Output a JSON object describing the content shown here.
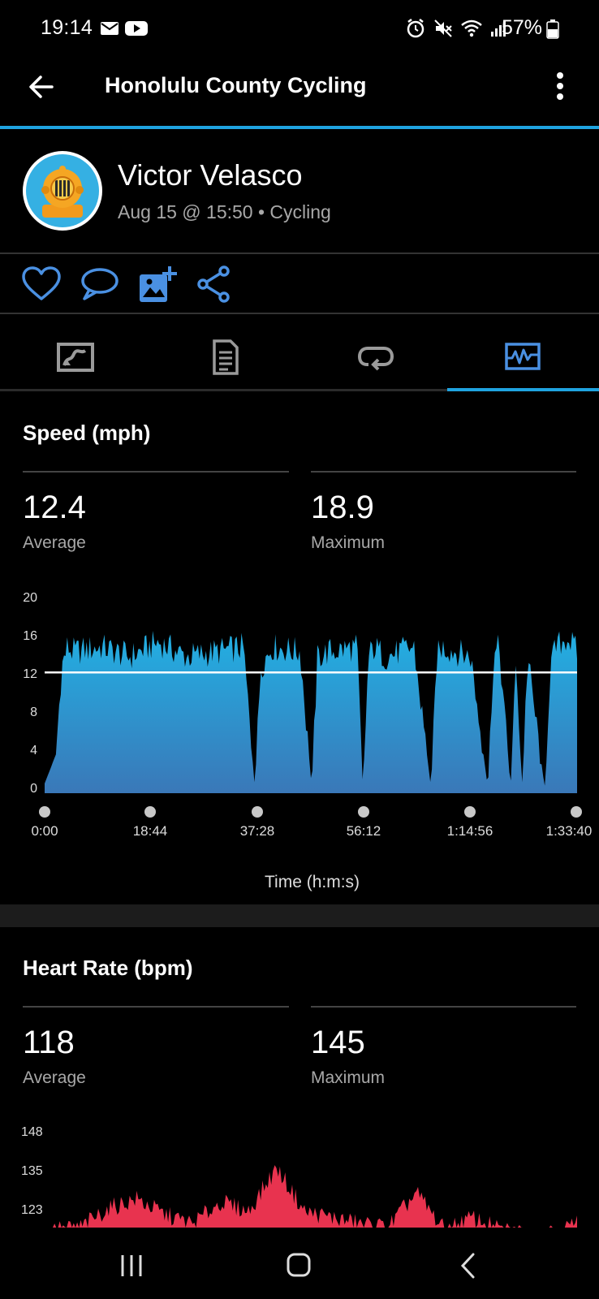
{
  "status_bar": {
    "time": "19:14",
    "battery": "57%"
  },
  "app_bar": {
    "title": "Honolulu County Cycling"
  },
  "activity": {
    "user_name": "Victor Velasco",
    "subline": "Aug 15 @ 15:50 • Cycling"
  },
  "speed": {
    "title": "Speed (mph)",
    "average": "12.4",
    "average_label": "Average",
    "maximum": "18.9",
    "maximum_label": "Maximum",
    "y_ticks": [
      "20",
      "16",
      "12",
      "8",
      "4",
      "0"
    ],
    "x_ticks": [
      "0:00",
      "18:44",
      "37:28",
      "56:12",
      "1:14:56",
      "1:33:40"
    ],
    "x_title": "Time (h:m:s)"
  },
  "heart_rate": {
    "title": "Heart Rate (bpm)",
    "average": "118",
    "average_label": "Average",
    "maximum": "145",
    "maximum_label": "Maximum",
    "y_ticks": [
      "148",
      "135",
      "123"
    ]
  },
  "colors": {
    "accent": "#1fa3e0",
    "speed_fill": "#29a8dc",
    "hr_fill": "#e8334f"
  },
  "chart_data": [
    {
      "type": "area",
      "title": "Speed (mph)",
      "xlabel": "Time (h:m:s)",
      "ylabel": "",
      "ylim": [
        0,
        20
      ],
      "x_ticks": [
        "0:00",
        "18:44",
        "37:28",
        "56:12",
        "1:14:56",
        "1:33:40"
      ],
      "x_minutes": [
        0,
        2,
        3,
        4,
        5,
        10,
        15,
        20,
        25,
        30,
        35,
        37,
        38,
        40,
        45,
        47,
        48,
        50,
        55,
        56,
        57,
        58,
        60,
        65,
        68,
        69,
        70,
        75,
        78,
        79,
        80,
        82,
        83,
        84,
        85,
        88,
        89,
        90,
        92,
        93.7
      ],
      "y_speed": [
        1,
        4,
        13,
        15,
        14.5,
        15,
        14,
        15.5,
        14,
        14.5,
        15,
        0.5,
        13,
        15,
        14.5,
        0.5,
        14,
        14.5,
        15,
        0.5,
        14,
        15,
        14,
        15,
        0.5,
        14,
        15,
        14,
        0.5,
        14,
        15,
        0.5,
        14,
        0.5,
        14,
        0.5,
        13,
        15,
        16,
        14.5
      ],
      "average_line": 12.4
    },
    {
      "type": "area",
      "title": "Heart Rate (bpm)",
      "xlabel": "",
      "ylabel": "",
      "y_ticks": [
        148,
        135,
        123
      ],
      "x_minutes": [
        0,
        5,
        10,
        15,
        20,
        25,
        30,
        35,
        40,
        45,
        50,
        55,
        60,
        65,
        70,
        75,
        80,
        85,
        90,
        93.7
      ],
      "y_bpm": [
        118,
        119,
        125,
        128,
        123,
        120,
        127,
        124,
        138,
        124,
        122,
        120,
        119,
        130,
        118,
        122,
        118,
        117,
        118,
        120
      ],
      "average_line": 118
    }
  ]
}
